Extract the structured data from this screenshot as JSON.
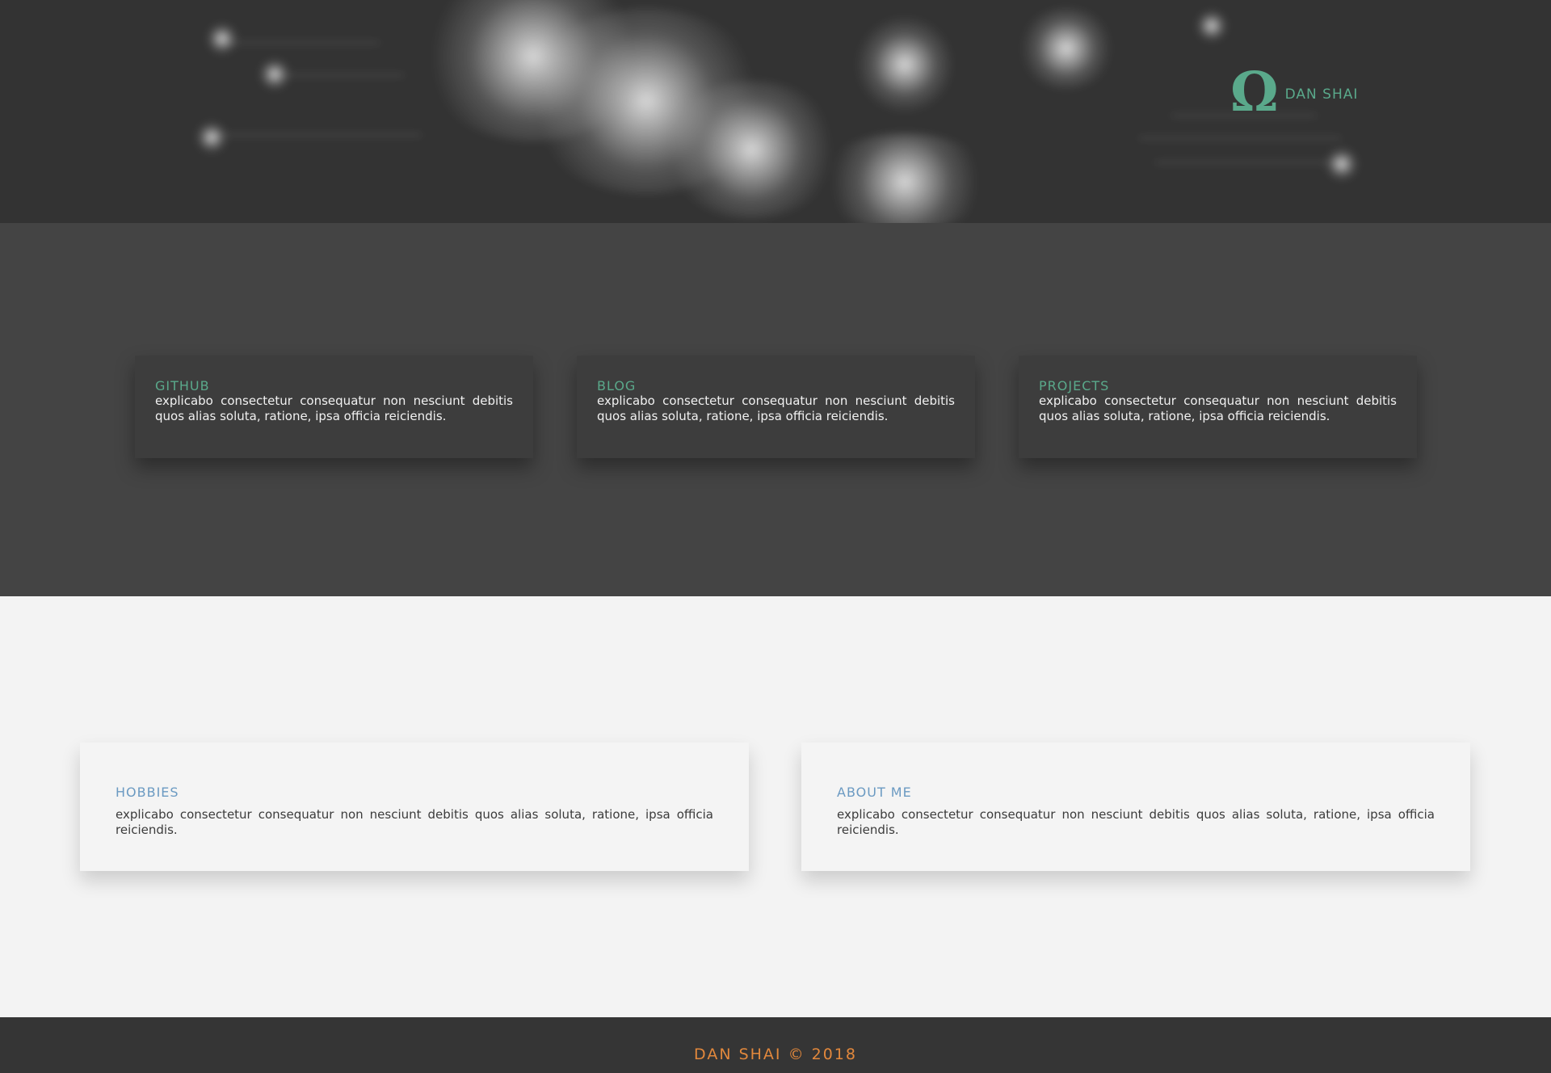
{
  "brand": {
    "logo_icon": "omega-icon",
    "logo_glyph": "Ω",
    "name": "DAN SHAI",
    "color": "#5aa98b"
  },
  "top_cards": [
    {
      "title": "GITHUB",
      "text": "explicabo consectetur consequatur non nesciunt debitis quos alias soluta, ratione, ipsa officia reiciendis."
    },
    {
      "title": "BLOG",
      "text": "explicabo consectetur consequatur non nesciunt debitis quos alias soluta, ratione, ipsa officia reiciendis."
    },
    {
      "title": "PROJECTS",
      "text": "explicabo consectetur consequatur non nesciunt debitis quos alias soluta, ratione, ipsa officia reiciendis."
    }
  ],
  "bottom_cards": [
    {
      "title": "HOBBIES",
      "text": "explicabo consectetur consequatur non nesciunt debitis quos alias soluta, ratione, ipsa officia reiciendis."
    },
    {
      "title": "ABOUT ME",
      "text": "explicabo consectetur consequatur non nesciunt debitis quos alias soluta, ratione, ipsa officia reiciendis."
    }
  ],
  "footer": {
    "text": "DAN SHAI © 2018",
    "color": "#e2883c"
  },
  "colors": {
    "hero_bg": "#333333",
    "dark_band": "#444444",
    "dark_card": "#3d3d3d",
    "light_band": "#f3f3f3",
    "title_green": "#5aa98b",
    "title_blue": "#6b9ac2",
    "footer_bg": "#353535"
  }
}
